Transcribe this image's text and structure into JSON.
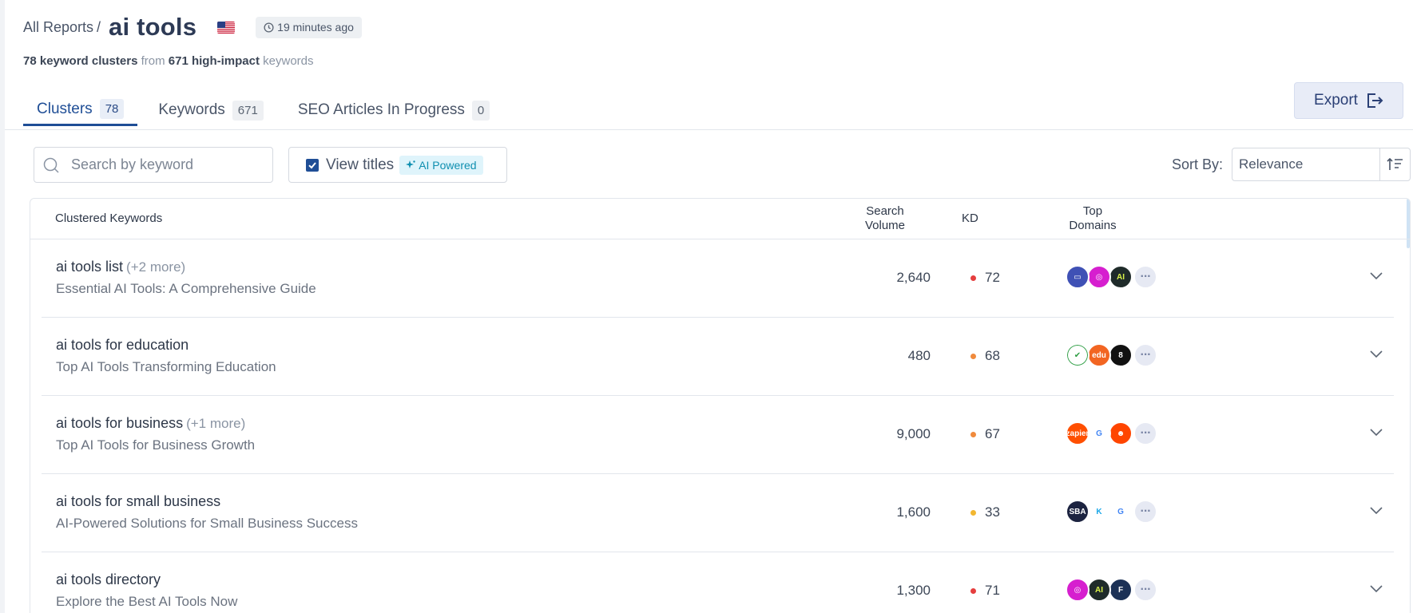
{
  "header": {
    "breadcrumb": "All Reports",
    "separator": "/",
    "title": "ai tools",
    "flag_icon": "us-flag-icon",
    "updated": "19 minutes ago"
  },
  "summary": {
    "clusters": "78 keyword clusters",
    "from": "from",
    "keywords": "671 high-impact",
    "suffix": "keywords"
  },
  "tabs": [
    {
      "label": "Clusters",
      "count": "78",
      "active": true
    },
    {
      "label": "Keywords",
      "count": "671",
      "active": false
    },
    {
      "label": "SEO Articles In Progress",
      "count": "0",
      "active": false
    }
  ],
  "export": {
    "label": "Export"
  },
  "search": {
    "placeholder": "Search by keyword",
    "value": ""
  },
  "view_titles": {
    "label": "View titles",
    "checked": true,
    "badge": "AI Powered"
  },
  "sort": {
    "label": "Sort By:",
    "value": "Relevance"
  },
  "table": {
    "headers": {
      "keywords": "Clustered Keywords",
      "volume_line1": "Search",
      "volume_line2": "Volume",
      "kd": "KD",
      "domains_line1": "Top",
      "domains_line2": "Domains"
    },
    "rows": [
      {
        "keyword": "ai tools list",
        "more": "(+2 more)",
        "title": "Essential AI Tools: A Comprehensive Guide",
        "volume": "2,640",
        "kd": "72",
        "kd_color": "#e53e3e",
        "domains": [
          {
            "bg": "#3f51b5",
            "txt": "▭"
          },
          {
            "bg": "#d61fcf",
            "txt": "◎"
          },
          {
            "bg": "#1f2b2a",
            "txt": "AI",
            "fg": "#d9f24a"
          }
        ]
      },
      {
        "keyword": "ai tools for education",
        "more": "",
        "title": "Top AI Tools Transforming Education",
        "volume": "480",
        "kd": "68",
        "kd_color": "#f08a3c",
        "domains": [
          {
            "bg": "#ffffff",
            "txt": "✔",
            "fg": "#2e9e44",
            "border": "#2e9e44"
          },
          {
            "bg": "#f26522",
            "txt": "edu"
          },
          {
            "bg": "#111111",
            "txt": "8"
          }
        ]
      },
      {
        "keyword": "ai tools for business",
        "more": "(+1 more)",
        "title": "Top AI Tools for Business Growth",
        "volume": "9,000",
        "kd": "67",
        "kd_color": "#f08a3c",
        "domains": [
          {
            "bg": "#ff4f00",
            "txt": "zapier"
          },
          {
            "bg": "#ffffff",
            "txt": "G",
            "fg": "#4285f4"
          },
          {
            "bg": "#ff4500",
            "txt": "☻"
          }
        ]
      },
      {
        "keyword": "ai tools for small business",
        "more": "",
        "title": "AI-Powered Solutions for Small Business Success",
        "volume": "1,600",
        "kd": "33",
        "kd_color": "#f2b731",
        "domains": [
          {
            "bg": "#1c2340",
            "txt": "SBA"
          },
          {
            "bg": "#ffffff",
            "txt": "K",
            "fg": "#1aa7e8"
          },
          {
            "bg": "#ffffff",
            "txt": "G",
            "fg": "#4285f4"
          }
        ]
      },
      {
        "keyword": "ai tools directory",
        "more": "",
        "title": "Explore the Best AI Tools Now",
        "volume": "1,300",
        "kd": "71",
        "kd_color": "#e53e3e",
        "domains": [
          {
            "bg": "#d61fcf",
            "txt": "◎"
          },
          {
            "bg": "#1f2b2a",
            "txt": "AI",
            "fg": "#d9f24a"
          },
          {
            "bg": "#1c3156",
            "txt": "F"
          }
        ]
      }
    ]
  }
}
